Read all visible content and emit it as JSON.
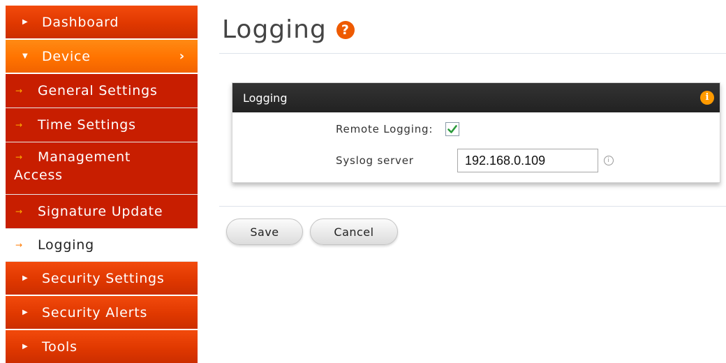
{
  "sidebar": {
    "dashboard": "Dashboard",
    "device": "Device",
    "device_sub": [
      "General Settings",
      "Time Settings",
      "Management",
      "Access",
      "Signature Update",
      "Logging"
    ],
    "security_settings": "Security Settings",
    "security_alerts": "Security Alerts",
    "tools": "Tools"
  },
  "page": {
    "title": "Logging"
  },
  "panel": {
    "title": "Logging",
    "remote_logging_label": "Remote Logging:",
    "remote_logging_checked": true,
    "syslog_label": "Syslog server",
    "syslog_value": "192.168.0.109"
  },
  "buttons": {
    "save": "Save",
    "cancel": "Cancel"
  },
  "colors": {
    "menu_red": "#c81e00",
    "menu_orange": "#ff7300",
    "header_dark": "#222222",
    "accent": "#ee5a00",
    "check_green": "#2a9a3a"
  }
}
